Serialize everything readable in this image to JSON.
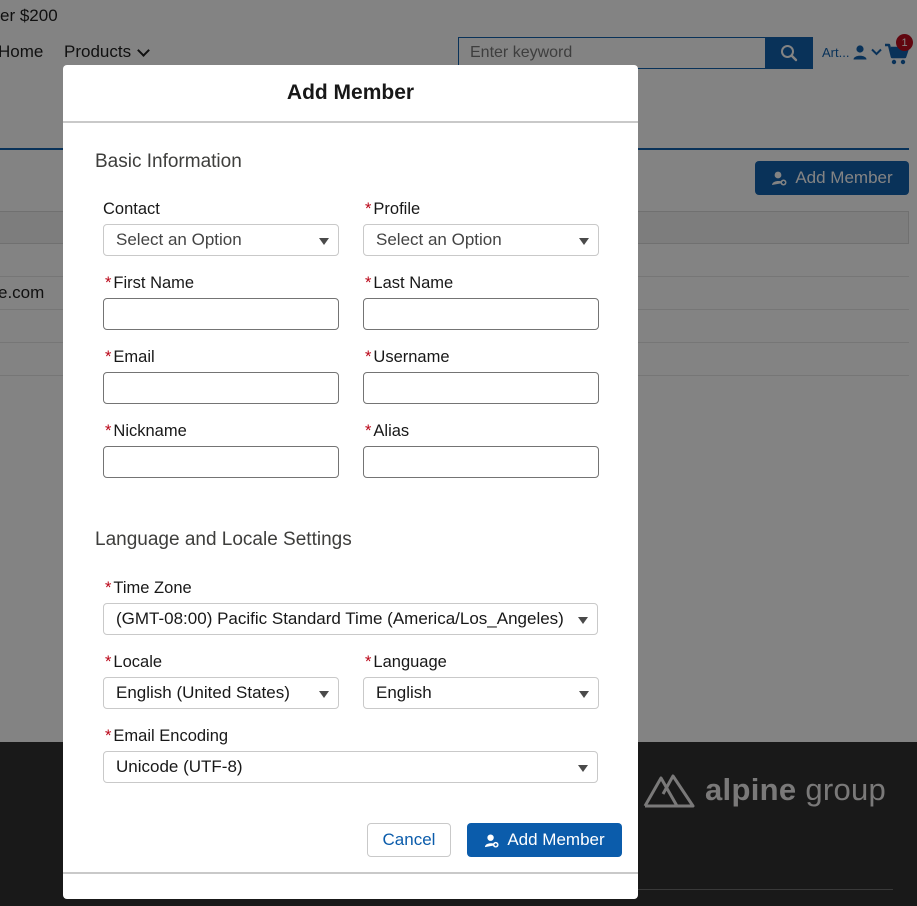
{
  "background": {
    "promo_text": "er $200",
    "nav": {
      "home_label": "Home",
      "products_label": "Products"
    },
    "search": {
      "placeholder": "Enter keyword"
    },
    "user_menu_label": "Art...",
    "cart_badge_count": "1",
    "add_member_button_label": "Add Member",
    "table_rows": [
      "",
      "e.com",
      "",
      ""
    ],
    "footer_brand": {
      "bold": "alpine",
      "regular": "group"
    }
  },
  "modal": {
    "title": "Add Member",
    "sections": {
      "basic": "Basic Information",
      "locale": "Language and Locale Settings"
    },
    "fields": {
      "contact": {
        "label": "Contact",
        "value": "Select an Option"
      },
      "profile": {
        "label": "Profile",
        "value": "Select an Option"
      },
      "first_name": {
        "label": "First Name",
        "value": ""
      },
      "last_name": {
        "label": "Last Name",
        "value": ""
      },
      "email": {
        "label": "Email",
        "value": ""
      },
      "username": {
        "label": "Username",
        "value": ""
      },
      "nickname": {
        "label": "Nickname",
        "value": ""
      },
      "alias": {
        "label": "Alias",
        "value": ""
      },
      "time_zone": {
        "label": "Time Zone",
        "value": "(GMT-08:00) Pacific Standard Time (America/Los_Angeles)"
      },
      "locale": {
        "label": "Locale",
        "value": "English (United States)"
      },
      "language": {
        "label": "Language",
        "value": "English"
      },
      "email_encoding": {
        "label": "Email Encoding",
        "value": "Unicode (UTF-8)"
      }
    },
    "required_marker": "*",
    "cancel_label": "Cancel",
    "submit_label": "Add Member"
  },
  "colors": {
    "brand_blue": "#0b5cab",
    "required_red": "#ba0517",
    "overlay": "rgba(8,8,8,0.5)",
    "footer_bg": "#2b2b2b"
  }
}
